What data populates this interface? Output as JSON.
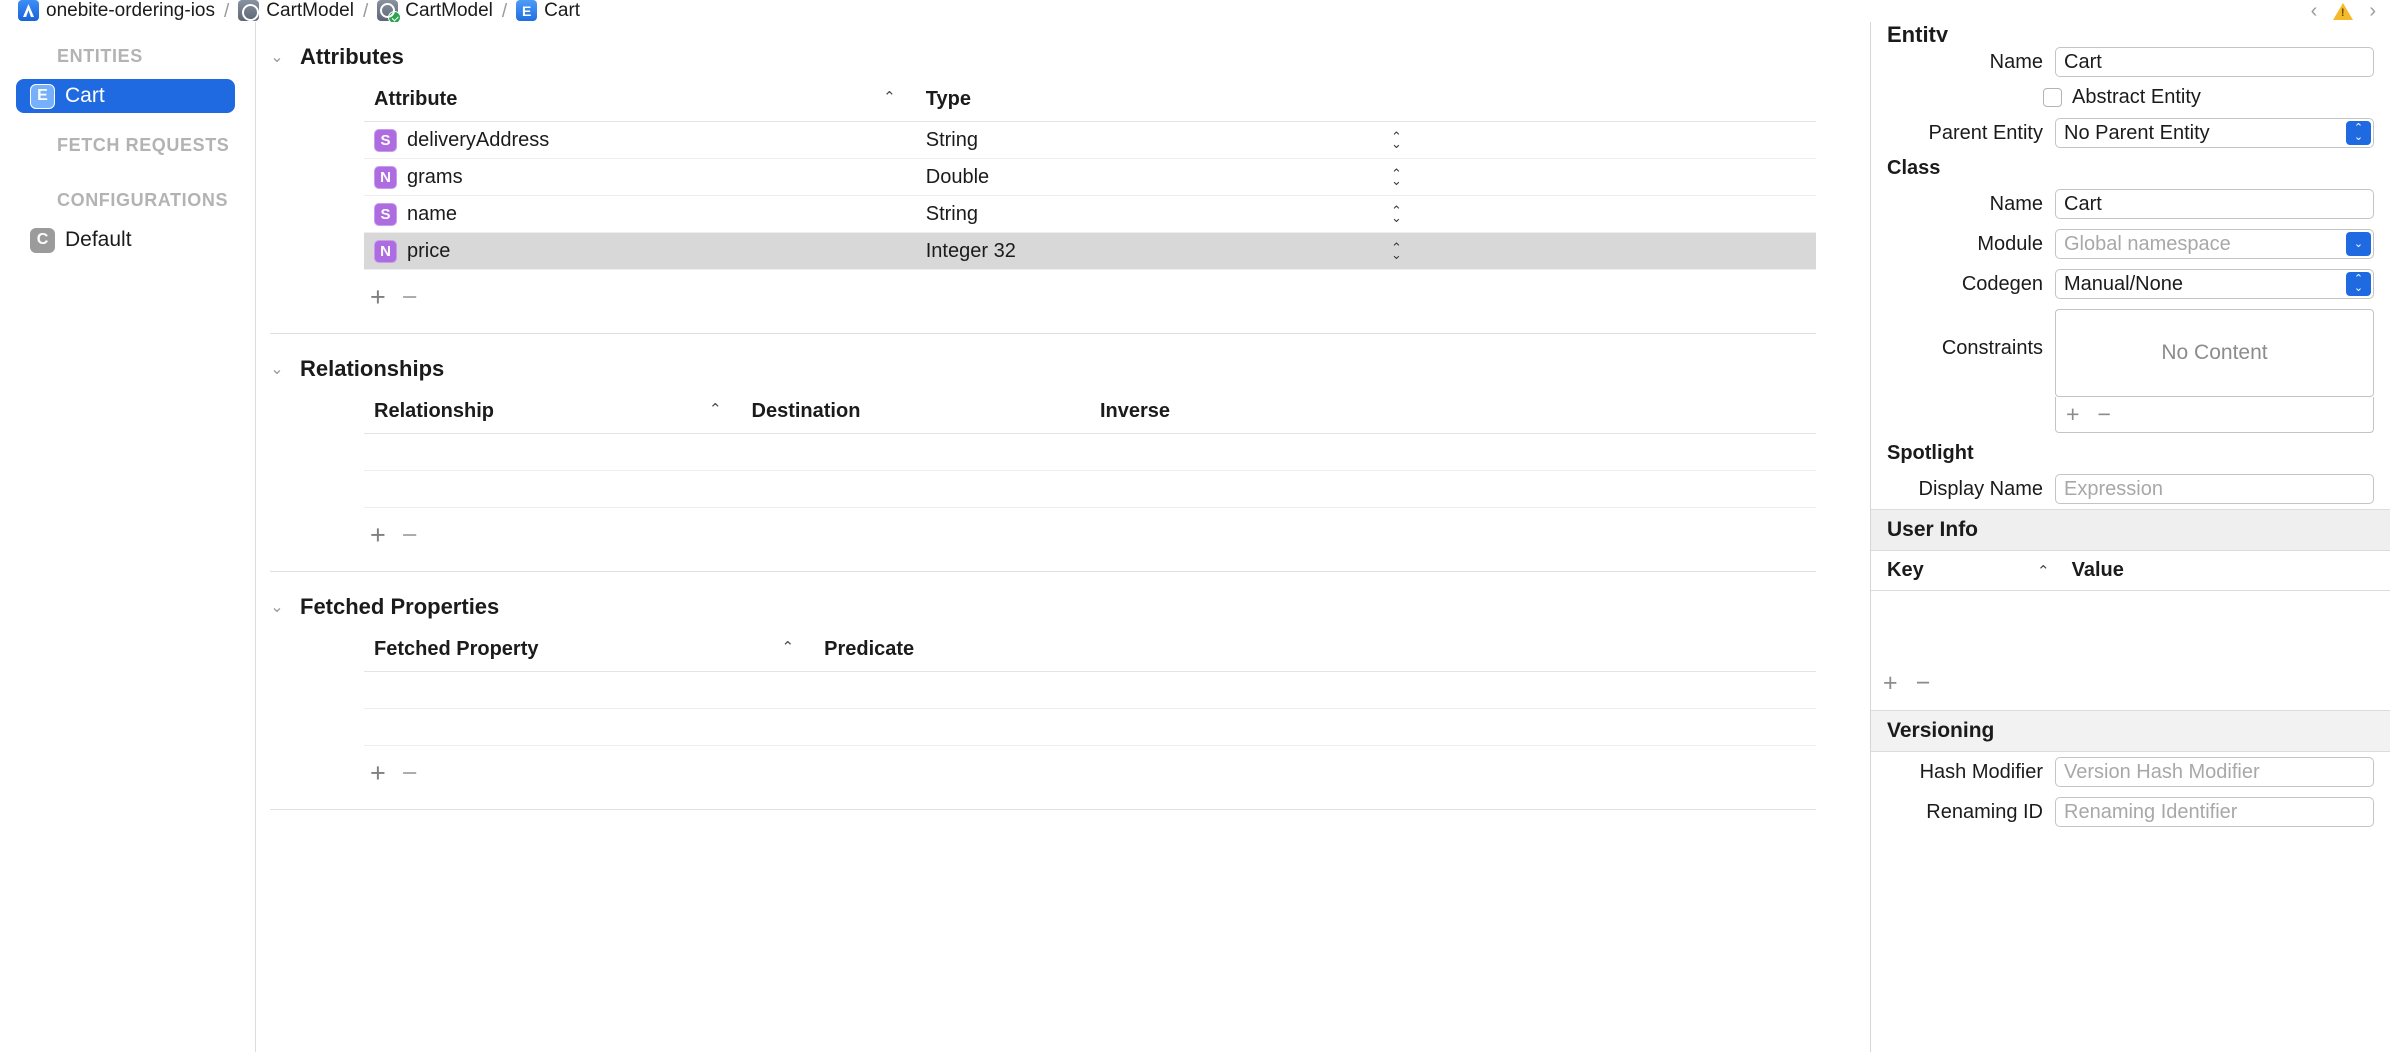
{
  "breadcrumb": {
    "items": [
      {
        "label": "onebite-ordering-ios",
        "icon": "app-project-icon"
      },
      {
        "label": "CartModel",
        "icon": "datamodel-icon"
      },
      {
        "label": "CartModel",
        "icon": "datamodel-version-icon"
      },
      {
        "label": "Cart",
        "icon": "entity-icon"
      }
    ],
    "separator": "/",
    "nav_back": "‹",
    "nav_forward": "›",
    "warning_icon": "warning-triangle-icon"
  },
  "sidebar": {
    "sections": [
      {
        "title": "ENTITIES",
        "items": [
          {
            "label": "Cart",
            "badge": "E",
            "selected": true
          }
        ]
      },
      {
        "title": "FETCH REQUESTS",
        "items": []
      },
      {
        "title": "CONFIGURATIONS",
        "items": [
          {
            "label": "Default",
            "badge": "C",
            "selected": false
          }
        ]
      }
    ]
  },
  "editor": {
    "attributes": {
      "title": "Attributes",
      "disclosure": "⌄",
      "columns": [
        "Attribute",
        "Type"
      ],
      "sort_caret": "⌃",
      "rows": [
        {
          "badge": "S",
          "name": "deliveryAddress",
          "type": "String",
          "selected": false
        },
        {
          "badge": "N",
          "name": "grams",
          "type": "Double",
          "selected": false
        },
        {
          "badge": "S",
          "name": "name",
          "type": "String",
          "selected": false
        },
        {
          "badge": "N",
          "name": "price",
          "type": "Integer 32",
          "selected": true
        }
      ],
      "add_label": "+",
      "remove_label": "−"
    },
    "relationships": {
      "title": "Relationships",
      "disclosure": "⌄",
      "columns": [
        "Relationship",
        "Destination",
        "Inverse"
      ],
      "sort_caret": "⌃",
      "rows": [],
      "empty_row_count": 3,
      "add_label": "+",
      "remove_label": "−"
    },
    "fetched_properties": {
      "title": "Fetched Properties",
      "disclosure": "⌄",
      "columns": [
        "Fetched Property",
        "Predicate"
      ],
      "sort_caret": "⌃",
      "rows": [],
      "empty_row_count": 3,
      "add_label": "+",
      "remove_label": "−"
    }
  },
  "inspector": {
    "entity": {
      "header": "Entity",
      "name_label": "Name",
      "name_value": "Cart",
      "abstract_label": "Abstract Entity",
      "abstract_checked": false,
      "parent_label": "Parent Entity",
      "parent_value": "No Parent Entity"
    },
    "class": {
      "header": "Class",
      "name_label": "Name",
      "name_value": "Cart",
      "module_label": "Module",
      "module_placeholder": "Global namespace",
      "codegen_label": "Codegen",
      "codegen_value": "Manual/None"
    },
    "constraints": {
      "label": "Constraints",
      "empty_text": "No Content",
      "add_label": "+",
      "remove_label": "−"
    },
    "spotlight": {
      "header": "Spotlight",
      "display_name_label": "Display Name",
      "display_name_placeholder": "Expression"
    },
    "user_info": {
      "header": "User Info",
      "columns": [
        "Key",
        "Value"
      ],
      "sort_caret": "⌃",
      "add_label": "+",
      "remove_label": "−"
    },
    "versioning": {
      "header": "Versioning",
      "hash_modifier_label": "Hash Modifier",
      "hash_modifier_placeholder": "Version Hash Modifier",
      "renaming_id_label": "Renaming ID",
      "renaming_id_placeholder": "Renaming Identifier"
    }
  },
  "colors": {
    "accent_blue": "#1f6ae0",
    "attribute_purple": "#ad6de0",
    "selection_grey": "#d8d8d8"
  }
}
